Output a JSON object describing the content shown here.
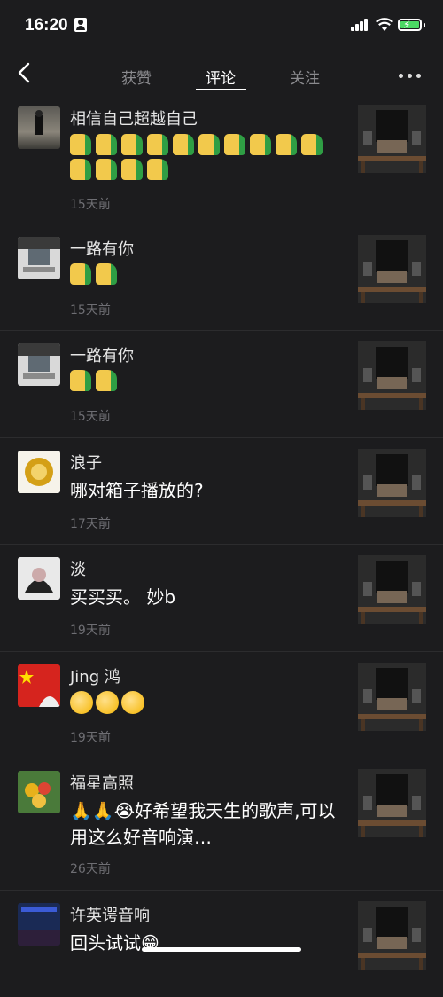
{
  "status": {
    "time": "16:20"
  },
  "nav": {
    "tabs": [
      {
        "label": "获赞"
      },
      {
        "label": "评论"
      },
      {
        "label": "关注"
      }
    ],
    "active_tab": 1
  },
  "comments": [
    {
      "name": "相信自己超越自己",
      "content_type": "emoji",
      "emoji_icons": [
        "thumbs-up",
        "thumbs-up",
        "thumbs-up",
        "thumbs-up",
        "thumbs-up",
        "thumbs-up",
        "thumbs-up",
        "thumbs-up",
        "thumbs-up",
        "thumbs-up",
        "thumbs-up",
        "thumbs-up",
        "thumbs-up",
        "thumbs-up"
      ],
      "time": "15天前"
    },
    {
      "name": "一路有你",
      "content_type": "emoji",
      "emoji_icons": [
        "thumbs-up",
        "thumbs-up"
      ],
      "time": "15天前"
    },
    {
      "name": "一路有你",
      "content_type": "emoji",
      "emoji_icons": [
        "thumbs-up",
        "thumbs-up"
      ],
      "time": "15天前"
    },
    {
      "name": "浪子",
      "content_type": "text",
      "text": "哪对箱子播放的?",
      "time": "17天前"
    },
    {
      "name": "淡",
      "content_type": "text",
      "text": "买买买。 妙b",
      "time": "19天前"
    },
    {
      "name": "Jing 鸿",
      "content_type": "emoji",
      "emoji_icons": [
        "smile-666-face",
        "smile-666-face",
        "smile-666-face"
      ],
      "time": "19天前"
    },
    {
      "name": "福星高照",
      "content_type": "text",
      "text": "🙏🙏😭好希望我天生的歌声,可以用这么好音响演…",
      "time": "26天前"
    },
    {
      "name": "许英谔音响",
      "content_type": "text",
      "text": "回头试试😁",
      "time": ""
    }
  ]
}
